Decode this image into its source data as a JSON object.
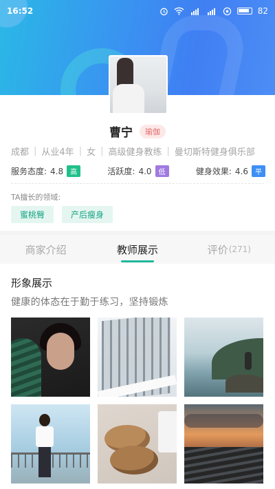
{
  "status_bar": {
    "time": "16:52",
    "battery": "82",
    "icons": [
      "alarm-icon",
      "wifi-icon",
      "signal-4g-icon",
      "signal-icon",
      "notification-icon",
      "battery-icon"
    ]
  },
  "profile": {
    "name": "曹宁",
    "specialty_tag": "瑜伽",
    "info": [
      "成都",
      "从业4年",
      "女",
      "高级健身教练",
      "曼切斯特健身俱乐部"
    ],
    "stats": [
      {
        "label": "服务态度:",
        "value": "4.8",
        "badge": "高",
        "badge_color": "#21c08b"
      },
      {
        "label": "活跃度:",
        "value": "4.0",
        "badge": "低",
        "badge_color": "#a07ae0"
      },
      {
        "label": "健身效果:",
        "value": "4.6",
        "badge": "平",
        "badge_color": "#3d8ff5"
      }
    ],
    "fields_label": "TA擅长的领域:",
    "fields": [
      "蜜桃臀",
      "产后瘦身"
    ]
  },
  "tabs": [
    {
      "label": "商家介绍",
      "count": ""
    },
    {
      "label": "教师展示",
      "count": ""
    },
    {
      "label": "评价",
      "count": "(271)"
    }
  ],
  "active_tab": 1,
  "gallery": {
    "title": "形象展示",
    "subtitle": "健康的体态在于勤于练习，坚持锻炼"
  },
  "colors": {
    "accent": "#1fb89a",
    "banner_start": "#2ab8e6",
    "banner_end": "#3f7ff3"
  }
}
